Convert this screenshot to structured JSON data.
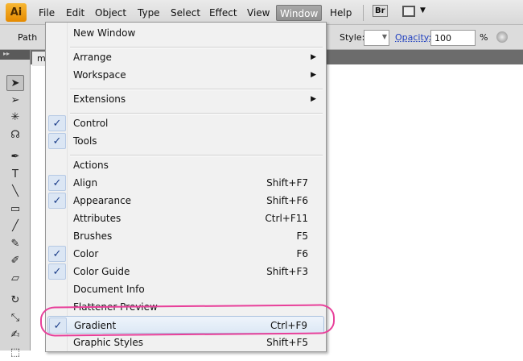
{
  "app": {
    "logo": "Ai"
  },
  "menubar": [
    "File",
    "Edit",
    "Object",
    "Type",
    "Select",
    "Effect",
    "View",
    "Window",
    "Help"
  ],
  "bridge": "Br",
  "control": {
    "path_label": "Path",
    "style_label": "Style:",
    "opacity_label": "Opacity:",
    "opacity_value": "100",
    "percent": "%"
  },
  "doc_tab": "m",
  "window_menu": [
    {
      "label": "New Window"
    },
    {
      "sep": true
    },
    {
      "label": "Arrange",
      "submenu": true
    },
    {
      "label": "Workspace",
      "submenu": true
    },
    {
      "sep": true
    },
    {
      "label": "Extensions",
      "submenu": true
    },
    {
      "sep": true
    },
    {
      "label": "Control",
      "checked": true
    },
    {
      "label": "Tools",
      "checked": true
    },
    {
      "sep": true
    },
    {
      "label": "Actions"
    },
    {
      "label": "Align",
      "checked": true,
      "shortcut": "Shift+F7"
    },
    {
      "label": "Appearance",
      "checked": true,
      "shortcut": "Shift+F6"
    },
    {
      "label": "Attributes",
      "shortcut": "Ctrl+F11"
    },
    {
      "label": "Brushes",
      "shortcut": "F5"
    },
    {
      "label": "Color",
      "checked": true,
      "shortcut": "F6"
    },
    {
      "label": "Color Guide",
      "checked": true,
      "shortcut": "Shift+F3"
    },
    {
      "label": "Document Info"
    },
    {
      "label": "Flattener Preview"
    },
    {
      "label": "Gradient",
      "checked": true,
      "shortcut": "Ctrl+F9",
      "highlighted": true
    },
    {
      "label": "Graphic Styles",
      "shortcut": "Shift+F5"
    }
  ],
  "tools": [
    "selection",
    "direct-selection",
    "magic-wand",
    "lasso",
    "pen",
    "type",
    "line",
    "rectangle",
    "paintbrush",
    "pencil",
    "blob-brush",
    "eraser",
    "rotate",
    "scale",
    "warp",
    "free-transform"
  ]
}
